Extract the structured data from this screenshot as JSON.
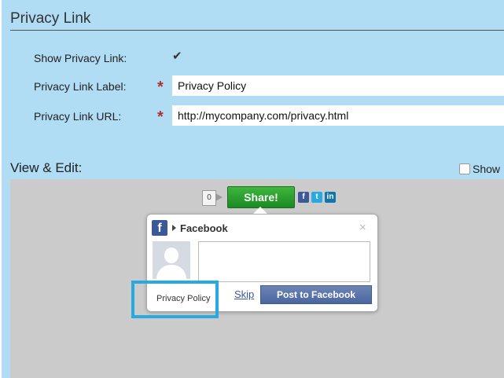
{
  "section": {
    "title": "Privacy Link"
  },
  "fields": {
    "show_label": "Show Privacy Link:",
    "show_checked": true,
    "label_label": "Privacy Link Label:",
    "label_value": "Privacy Policy",
    "url_label": "Privacy Link URL:",
    "url_value": "http://mycompany.com/privacy.html",
    "required_mark": "*"
  },
  "view": {
    "title": "View & Edit:",
    "show_label": "Show"
  },
  "preview": {
    "count": "0",
    "share_label": "Share!",
    "icons": [
      "facebook-icon",
      "twitter-icon",
      "linkedin-icon"
    ],
    "popup": {
      "network": "Facebook",
      "skip": "Skip",
      "post": "Post to Facebook",
      "privacy_link": "Privacy Policy"
    }
  },
  "colors": {
    "background": "#b0dcf4",
    "preview_bg": "#cbcbcb",
    "share_green": "#1a8a22",
    "facebook_blue": "#3b5998",
    "highlight": "#27a9e1"
  }
}
